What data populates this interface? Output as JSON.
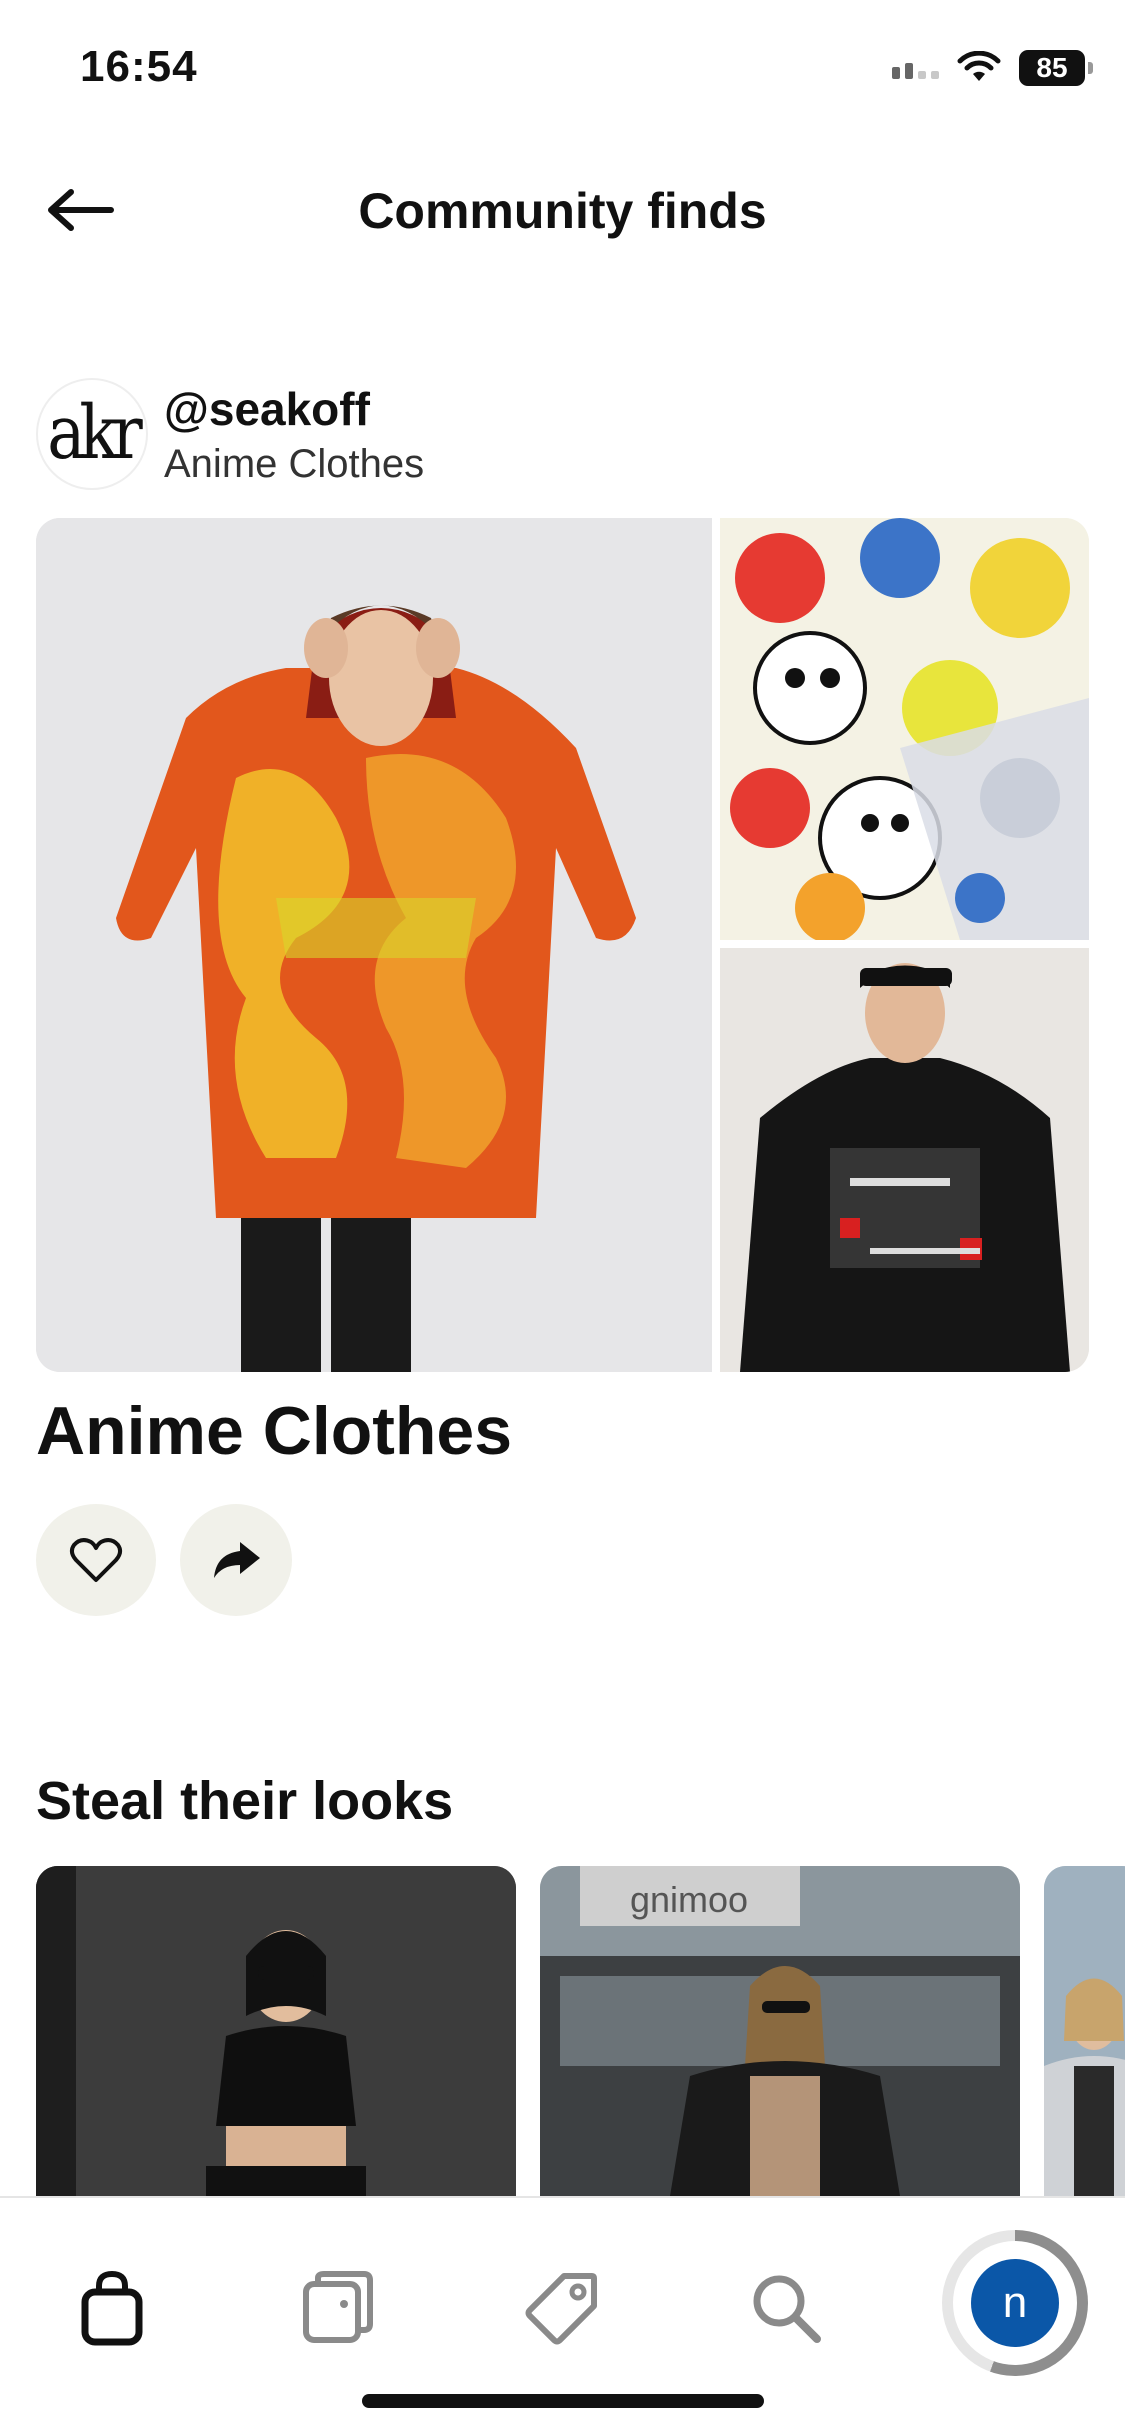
{
  "status_bar": {
    "time": "16:54",
    "battery": "85"
  },
  "header": {
    "title": "Community finds",
    "back_icon": "arrow-left-icon"
  },
  "profile": {
    "avatar_text": "akr",
    "username": "@seakoff",
    "board_name": "Anime Clothes"
  },
  "collage": {
    "title": "Anime Clothes",
    "images": [
      "fire-skeleton-hoodie-photo",
      "cartoon-pattern-fabric-photo",
      "itachi-sweatshirt-photo"
    ]
  },
  "actions": {
    "like_icon": "heart-icon",
    "share_icon": "share-arrow-icon"
  },
  "steal_their_looks": {
    "title": "Steal their looks",
    "looks": [
      "look-1",
      "look-2",
      "look-3"
    ],
    "storefront_text": "gnimoo"
  },
  "tab_bar": {
    "tabs": [
      "shopping-bag-icon",
      "boards-icon",
      "tag-icon",
      "search-icon"
    ],
    "profile_initial": "n"
  },
  "colors": {
    "accent": "#0b57a8",
    "button_bg": "#f1f1ea"
  }
}
